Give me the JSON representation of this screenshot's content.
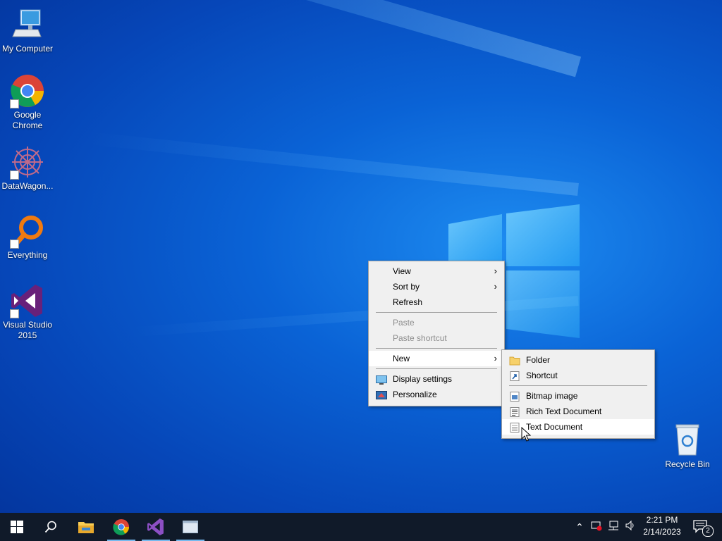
{
  "desktop": {
    "icons": [
      {
        "label": "My Computer",
        "icon": "my-computer-icon"
      },
      {
        "label": "Google Chrome",
        "icon": "chrome-icon"
      },
      {
        "label": "DataWagon...",
        "icon": "datawagon-icon"
      },
      {
        "label": "Everything",
        "icon": "everything-icon"
      },
      {
        "label": "Visual Studio 2015",
        "icon": "visual-studio-icon"
      },
      {
        "label": "Recycle Bin",
        "icon": "recycle-bin-icon"
      }
    ]
  },
  "context_menu": {
    "items": [
      {
        "label": "View",
        "submenu": true
      },
      {
        "label": "Sort by",
        "submenu": true
      },
      {
        "label": "Refresh"
      },
      {
        "label": "Paste",
        "disabled": true
      },
      {
        "label": "Paste shortcut",
        "disabled": true
      },
      {
        "label": "New",
        "submenu": true,
        "highlighted": true
      },
      {
        "label": "Display settings",
        "icon": "display-settings-icon"
      },
      {
        "label": "Personalize",
        "icon": "personalize-icon"
      }
    ]
  },
  "new_submenu": {
    "items": [
      {
        "label": "Folder",
        "icon": "folder-icon"
      },
      {
        "label": "Shortcut",
        "icon": "shortcut-icon"
      },
      {
        "label": "Bitmap image",
        "icon": "bitmap-icon"
      },
      {
        "label": "Rich Text Document",
        "icon": "rich-text-icon"
      },
      {
        "label": "Text Document",
        "icon": "text-document-icon",
        "highlighted": true
      }
    ]
  },
  "taskbar": {
    "apps": [
      "start-icon",
      "search-icon",
      "file-explorer-icon",
      "chrome-icon",
      "visual-studio-icon",
      "window-icon"
    ],
    "clock": {
      "time": "2:21 PM",
      "date": "2/14/2023"
    },
    "notifications": {
      "count": "2"
    }
  },
  "colors": {
    "taskbar": "#101a29",
    "menu_bg": "#f0f0f0",
    "menu_hover": "#ffffff",
    "accent": "#76b9ed"
  }
}
